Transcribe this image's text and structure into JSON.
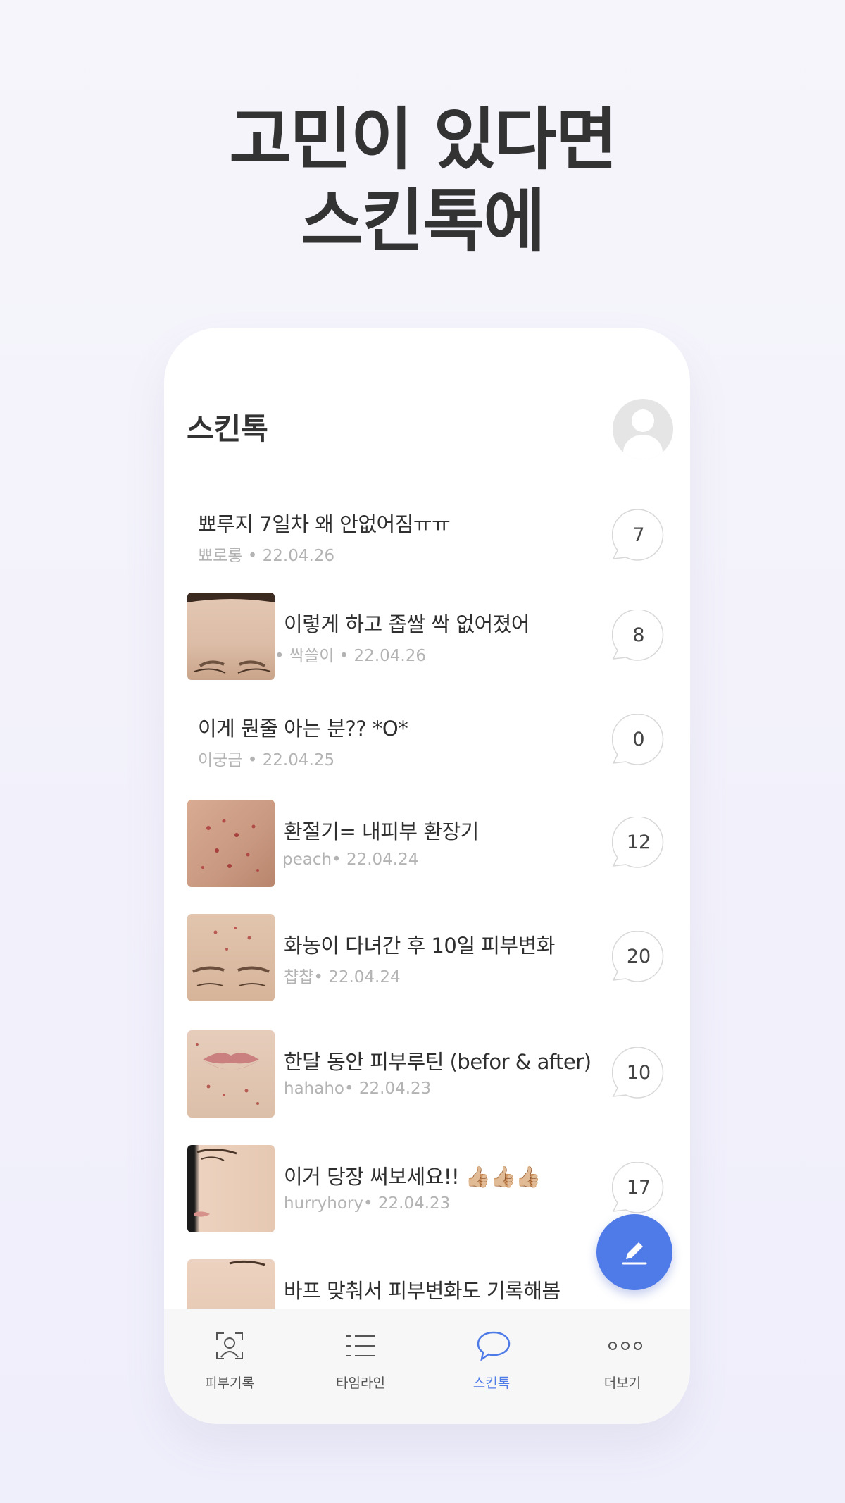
{
  "headline": {
    "line1": "고민이 있다면",
    "line2": "스킨톡에"
  },
  "app": {
    "title": "스킨톡"
  },
  "posts": [
    {
      "title": "뾰루지 7일차 왜 안없어짐ㅠㅠ",
      "author": "뾰로롱",
      "date": "22.04.26",
      "meta": "뾰로롱 • 22.04.26",
      "comments": "7",
      "has_thumb": false
    },
    {
      "title": "이렇게 하고 좁쌀 싹 없어졌어",
      "author": "싹쓸이",
      "date": "22.04.26",
      "meta": "• 싹쓸이 • 22.04.26",
      "comments": "8",
      "has_thumb": true
    },
    {
      "title": "이게 뭔줄 아는 분?? *O*",
      "author": "이궁금",
      "date": "22.04.25",
      "meta": "이궁금 • 22.04.25",
      "comments": "0",
      "has_thumb": false
    },
    {
      "title": "환절기= 내피부 환장기",
      "author": "peach",
      "date": "22.04.24",
      "meta": "peach• 22.04.24",
      "comments": "12",
      "has_thumb": true
    },
    {
      "title": "화농이 다녀간 후 10일 피부변화",
      "author": "챱챱",
      "date": "22.04.24",
      "meta": "챱챱• 22.04.24",
      "comments": "20",
      "has_thumb": true
    },
    {
      "title": "한달 동안 피부루틴 (befor & after)",
      "author": "hahaho",
      "date": "22.04.23",
      "meta": "hahaho• 22.04.23",
      "comments": "10",
      "has_thumb": true
    },
    {
      "title": "이거 당장 써보세요!! 👍🏼👍🏼👍🏼",
      "author": "hurryhory",
      "date": "22.04.23",
      "meta": "hurryhory• 22.04.23",
      "comments": "17",
      "has_thumb": true
    },
    {
      "title": "바프 맞춰서 피부변화도 기록해봄",
      "author": "",
      "date": "",
      "meta": "",
      "comments": "",
      "has_thumb": true
    }
  ],
  "tabs": [
    {
      "label": "피부기록",
      "icon": "face-scan-icon",
      "active": false
    },
    {
      "label": "타임라인",
      "icon": "list-icon",
      "active": false
    },
    {
      "label": "스킨톡",
      "icon": "chat-bubble-icon",
      "active": true
    },
    {
      "label": "더보기",
      "icon": "more-dots-icon",
      "active": false
    }
  ],
  "colors": {
    "accent": "#4f7be8",
    "text": "#333333",
    "meta": "#b3b3b3"
  }
}
